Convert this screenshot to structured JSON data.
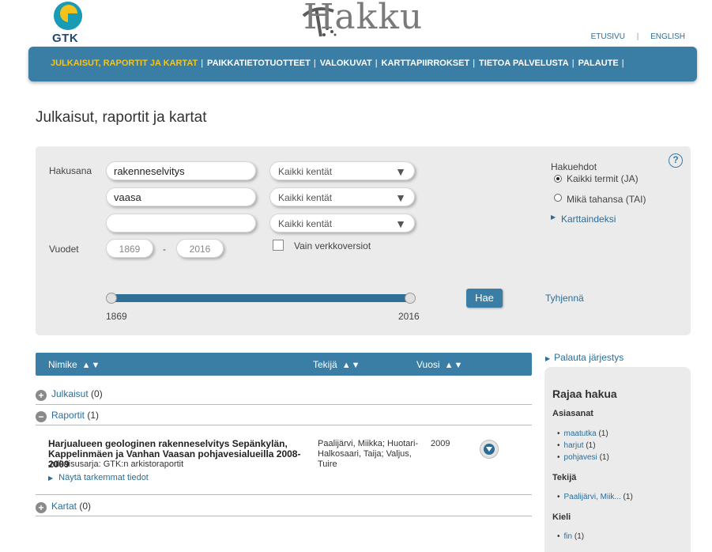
{
  "header": {
    "gtk_logo_text": "GTK",
    "hakku_logo_text": "Hakku",
    "top_links": [
      "ETUSIVU",
      "ENGLISH"
    ]
  },
  "nav": {
    "items": [
      {
        "label": "JULKAISUT, RAPORTIT JA KARTAT",
        "active": true
      },
      {
        "label": "PAIKKATIETOTUOTTEET",
        "active": false
      },
      {
        "label": "VALOKUVAT",
        "active": false
      },
      {
        "label": "KARTTAPIIRROKSET",
        "active": false
      },
      {
        "label": "TIETOA PALVELUSTA",
        "active": false
      },
      {
        "label": "PALAUTE",
        "active": false
      }
    ],
    "separator": "|"
  },
  "page_title": "Julkaisut, raportit ja kartat",
  "search": {
    "hakusana_label": "Hakusana",
    "terms": [
      "rakenneselvitys",
      "vaasa",
      ""
    ],
    "field_selects": [
      "Kaikki kentät",
      "Kaikki kentät",
      "Kaikki kentät"
    ],
    "vuodet_label": "Vuodet",
    "year_from": "1869",
    "year_to": "2016",
    "year_dash": "-",
    "only_online_label": "Vain verkkoversiot",
    "options_label": "Hakuehdot",
    "option_and": "Kaikki termit (JA)",
    "option_or": "Mikä tahansa (TAI)",
    "map_index_label": "Karttaindeksi",
    "slider_min_label": "1869",
    "slider_max_label": "2016",
    "search_button": "Hae",
    "clear_link": "Tyhjennä",
    "help_symbol": "?"
  },
  "results": {
    "columns": [
      "Nimike",
      "Tekijä",
      "Vuosi"
    ],
    "sort_arrows": "▲▼",
    "groups": [
      {
        "label": "Julkaisut",
        "count": "(0)",
        "symbol": "+"
      },
      {
        "label": "Raportit",
        "count": "(1)",
        "symbol": "−"
      },
      {
        "label": "Kartat",
        "count": "(0)",
        "symbol": "+"
      }
    ],
    "items": [
      {
        "title": "Harjualueen geologinen rakenneselvitys Sepänkylän, Kappelinmäen ja Vanhan Vaasan pohjavesialueilla 2008-2009",
        "series": "Julkaisusarja: GTK:n arkistoraportit",
        "more_link": "Näytä tarkemmat tiedot",
        "authors": "Paalijärvi, Miikka; Huotari-Halkosaari, Taija; Valjus, Tuire",
        "year": "2009"
      }
    ]
  },
  "sidebar": {
    "reset_order": "Palauta järjestys",
    "title": "Rajaa hakua",
    "sections": [
      {
        "title": "Asiasanat",
        "items": [
          {
            "label": "maatutka",
            "count": "(1)"
          },
          {
            "label": "harjut",
            "count": "(1)"
          },
          {
            "label": "pohjavesi",
            "count": "(1)"
          }
        ]
      },
      {
        "title": "Tekijä",
        "items": [
          {
            "label": "Paalijärvi, Miik...",
            "count": "(1)"
          }
        ]
      },
      {
        "title": "Kieli",
        "items": [
          {
            "label": "fin",
            "count": "(1)"
          }
        ]
      }
    ]
  },
  "colors": {
    "nav_bg": "#3a7ea6",
    "nav_active": "#f5c518",
    "link": "#2a6d99",
    "panel_bg": "#ebebeb"
  }
}
